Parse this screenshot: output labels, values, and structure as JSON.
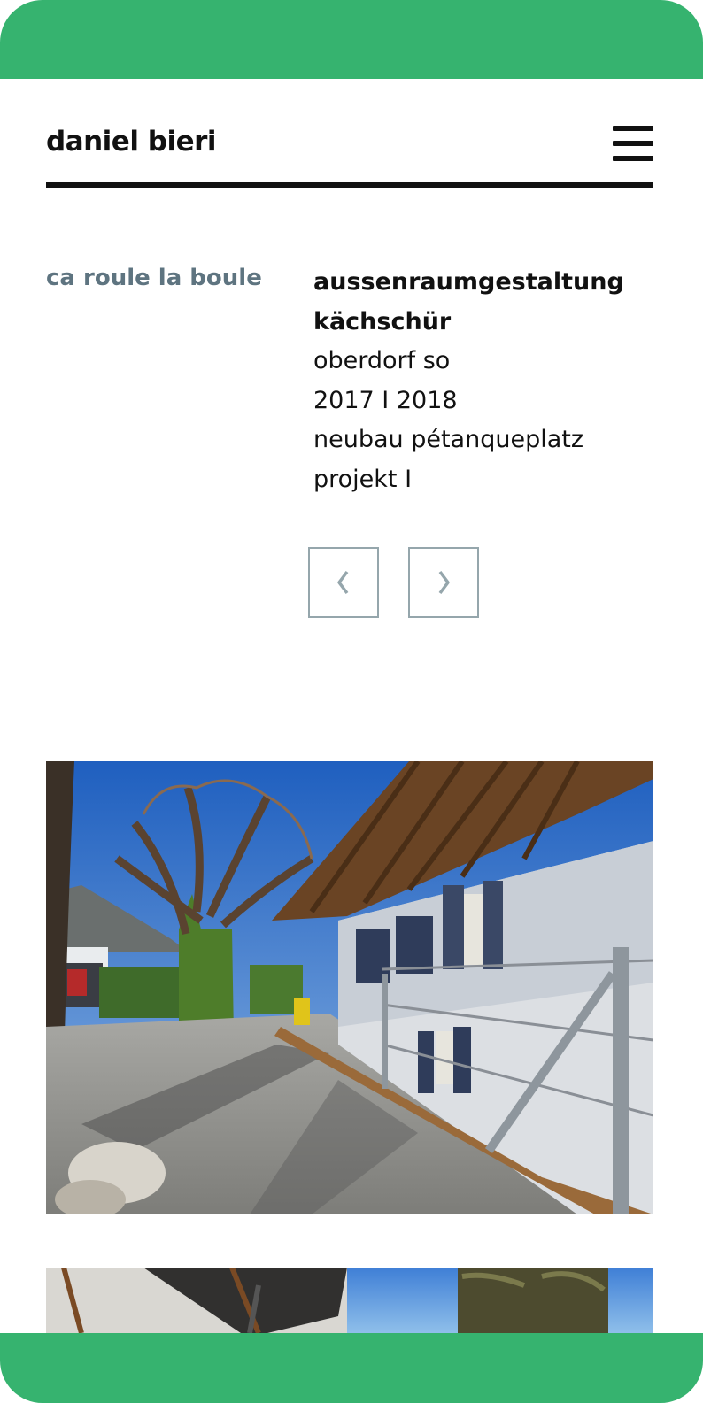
{
  "header": {
    "site_title": "daniel bieri",
    "menu_icon": "hamburger-menu-icon"
  },
  "project": {
    "category": "ca roule la boule",
    "title_line1": "aussenraumgestaltung",
    "title_line2": "kächschür",
    "location": "oberdorf so",
    "years": "2017 I 2018",
    "description": "neubau pétanqueplatz",
    "phase": "projekt I"
  },
  "navigation": {
    "prev_icon": "chevron-left-icon",
    "next_icon": "chevron-right-icon"
  },
  "colors": {
    "frame": "#36b36f",
    "accent_gray": "#5e7480",
    "button_border": "#95a6ac",
    "text": "#111111"
  }
}
